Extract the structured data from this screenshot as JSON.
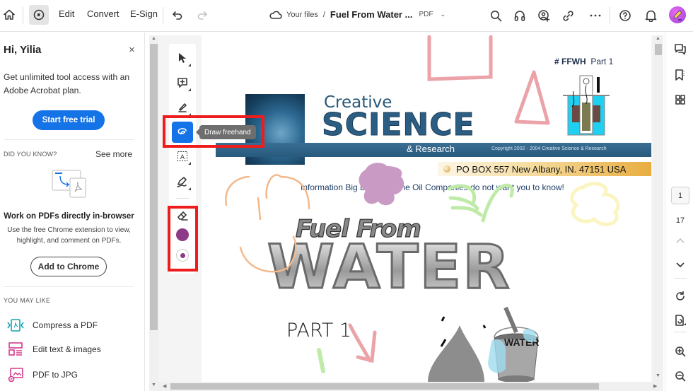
{
  "topbar": {
    "home_icon": "home-icon",
    "active_tool_icon": "annotate-tool-icon",
    "menu": [
      "Edit",
      "Convert",
      "E-Sign"
    ],
    "undo_icon": "undo-icon",
    "redo_icon": "redo-icon",
    "breadcrumb": {
      "cloud_icon": "cloud-icon",
      "location": "Your files",
      "separator": "/",
      "file_name": "Fuel From Water ...",
      "file_type": "PDF"
    },
    "right_icons": [
      "search-icon",
      "headset-icon",
      "share-user-icon",
      "link-icon",
      "more-icon",
      "help-icon",
      "bell-icon",
      "avatar"
    ]
  },
  "left_panel": {
    "greeting": "Hi, Yilia",
    "close_label": "×",
    "promo_text": "Get unlimited tool access with an Adobe Acrobat plan.",
    "trial_button": "Start free trial",
    "did_you_know_label": "DID YOU KNOW?",
    "see_more_label": "See more",
    "feature_title": "Work on PDFs directly in-browser",
    "feature_desc": "Use the free Chrome extension to view, highlight, and comment on PDFs.",
    "chrome_button": "Add to Chrome",
    "you_may_like_label": "YOU MAY LIKE",
    "suggestions": [
      {
        "label": "Compress a PDF",
        "icon": "compress-pdf-icon",
        "color": "#0fa3b1"
      },
      {
        "label": "Edit text & images",
        "icon": "edit-text-images-icon",
        "color": "#d43a8c"
      },
      {
        "label": "PDF to JPG",
        "icon": "pdf-to-jpg-icon",
        "color": "#d43a8c"
      }
    ]
  },
  "tool_rail": {
    "tools": [
      {
        "name": "select-tool",
        "icon": "cursor-icon"
      },
      {
        "name": "add-comment-tool",
        "icon": "comment-add-icon"
      },
      {
        "name": "highlight-tool",
        "icon": "highlighter-icon"
      },
      {
        "name": "draw-freehand-tool",
        "icon": "freehand-icon",
        "active": true
      },
      {
        "name": "text-box-tool",
        "icon": "text-box-icon"
      },
      {
        "name": "signature-tool",
        "icon": "pen-sign-icon"
      }
    ],
    "tooltip": "Draw freehand",
    "drawing_tools": [
      {
        "name": "eraser-tool",
        "icon": "eraser-icon"
      },
      {
        "name": "color-picker",
        "color": "#8e3a88"
      },
      {
        "name": "stroke-size-picker",
        "color": "#8e3a88"
      }
    ],
    "highlight_color": "#ee1c1c"
  },
  "pdf": {
    "tag_hash": "# FFWH",
    "tag_part": "Part 1",
    "logo_creative": "Creative",
    "logo_science": "SCIENCE",
    "logo_research": "& Research",
    "copyright": "Copyright 2002 - 2004 Creative Science & Research",
    "address": "PO BOX 557  New Albany, IN. 47151   USA",
    "tagline": "Information Big Brother & the Oil Companies do not want you to know!",
    "title_small": "Fuel From",
    "title_big": "WATER",
    "part_label": "PART 1",
    "bucket_label": "WATER",
    "annotation_colors": {
      "pink": "#eba3a8",
      "orange": "#f3b98c",
      "purple": "#c89ac4",
      "green": "#bfeaa8",
      "yellow": "#fbf5c2",
      "blue": "#9fdcef"
    }
  },
  "right_rail": {
    "icons": [
      "comments-icon",
      "bookmarks-icon",
      "thumbnails-icon"
    ],
    "current_page": "1",
    "total_pages": "17",
    "nav_icons": [
      "chevron-up-icon",
      "chevron-down-icon",
      "refresh-icon",
      "page-rotate-icon",
      "zoom-in-icon",
      "zoom-out-icon"
    ]
  }
}
